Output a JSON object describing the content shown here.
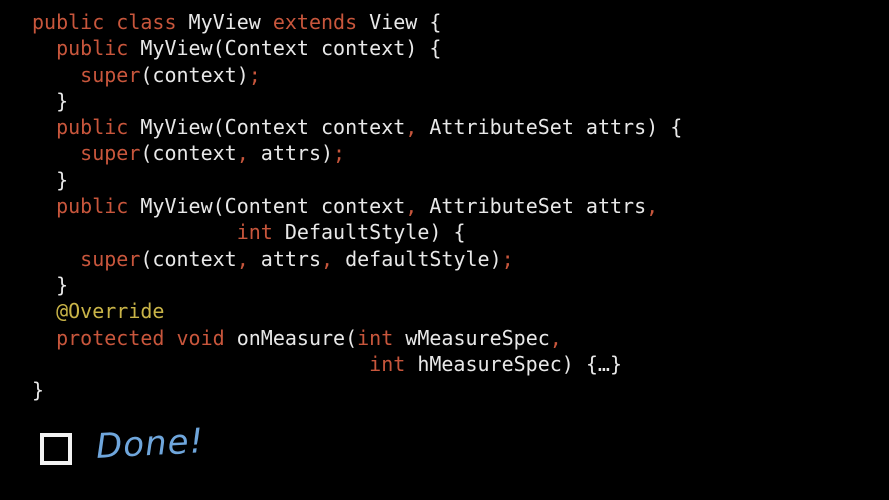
{
  "code": {
    "lines": [
      [
        {
          "t": "public class ",
          "c": "kw"
        },
        {
          "t": "MyView ",
          "c": "plain"
        },
        {
          "t": "extends ",
          "c": "kw"
        },
        {
          "t": "View {",
          "c": "plain"
        }
      ],
      [
        {
          "t": "  public ",
          "c": "kw"
        },
        {
          "t": "MyView(Context context) {",
          "c": "plain"
        }
      ],
      [
        {
          "t": "    super",
          "c": "kw"
        },
        {
          "t": "(context)",
          "c": "plain"
        },
        {
          "t": ";",
          "c": "kw"
        }
      ],
      [
        {
          "t": "  }",
          "c": "plain"
        }
      ],
      [
        {
          "t": "  public ",
          "c": "kw"
        },
        {
          "t": "MyView(Context context",
          "c": "plain"
        },
        {
          "t": ",",
          "c": "kw"
        },
        {
          "t": " AttributeSet attrs) {",
          "c": "plain"
        }
      ],
      [
        {
          "t": "    super",
          "c": "kw"
        },
        {
          "t": "(context",
          "c": "plain"
        },
        {
          "t": ",",
          "c": "kw"
        },
        {
          "t": " attrs)",
          "c": "plain"
        },
        {
          "t": ";",
          "c": "kw"
        }
      ],
      [
        {
          "t": "  }",
          "c": "plain"
        }
      ],
      [
        {
          "t": "  public ",
          "c": "kw"
        },
        {
          "t": "MyView(Content context",
          "c": "plain"
        },
        {
          "t": ",",
          "c": "kw"
        },
        {
          "t": " AttributeSet attrs",
          "c": "plain"
        },
        {
          "t": ",",
          "c": "kw"
        }
      ],
      [
        {
          "t": "                 int ",
          "c": "kw"
        },
        {
          "t": "DefaultStyle) {",
          "c": "plain"
        }
      ],
      [
        {
          "t": "    super",
          "c": "kw"
        },
        {
          "t": "(context",
          "c": "plain"
        },
        {
          "t": ",",
          "c": "kw"
        },
        {
          "t": " attrs",
          "c": "plain"
        },
        {
          "t": ",",
          "c": "kw"
        },
        {
          "t": " defaultStyle)",
          "c": "plain"
        },
        {
          "t": ";",
          "c": "kw"
        }
      ],
      [
        {
          "t": "  }",
          "c": "plain"
        }
      ],
      [
        {
          "t": "  @Override",
          "c": "ann"
        }
      ],
      [
        {
          "t": "  protected void ",
          "c": "kw"
        },
        {
          "t": "onMeasure(",
          "c": "plain"
        },
        {
          "t": "int ",
          "c": "kw"
        },
        {
          "t": "wMeasureSpec",
          "c": "plain"
        },
        {
          "t": ",",
          "c": "kw"
        }
      ],
      [
        {
          "t": "                            int ",
          "c": "kw"
        },
        {
          "t": "hMeasureSpec) {…}",
          "c": "plain"
        }
      ],
      [
        {
          "t": "}",
          "c": "plain"
        }
      ]
    ]
  },
  "task": {
    "label": "Done!",
    "checked": false
  },
  "colors": {
    "background": "#000000",
    "keyword": "#c8563c",
    "text": "#e8e8e8",
    "annotation": "#c9b448",
    "done_label": "#6fa6dc"
  }
}
